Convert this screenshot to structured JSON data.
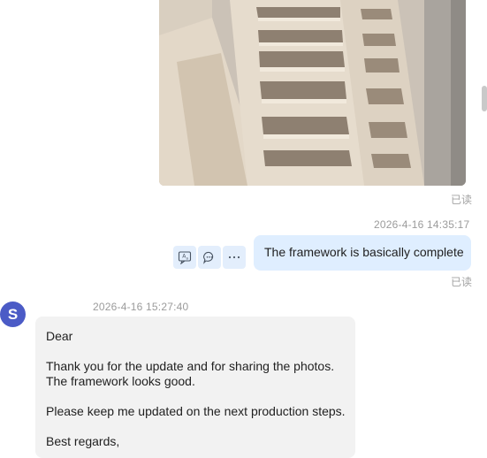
{
  "chat": {
    "image_message": {
      "read_status": "已读"
    },
    "outgoing_message": {
      "timestamp": "2026-4-16 14:35:17",
      "text": "The framework is basically complete",
      "read_status": "已读",
      "actions": [
        {
          "icon": "translate-icon"
        },
        {
          "icon": "reply-icon"
        },
        {
          "icon": "more-icon"
        }
      ]
    },
    "incoming_message": {
      "avatar_letter": "S",
      "avatar_color": "#4b5bc6",
      "timestamp": "2026-4-16 15:27:40",
      "lines": {
        "greeting": "Dear",
        "body1_line1": "Thank you for the update and for sharing the photos.",
        "body1_line2": "The framework looks good.",
        "body2": "Please keep me updated on the next production steps.",
        "closing": "Best regards,"
      }
    }
  },
  "colors": {
    "outgoing_bubble": "#dfeeff",
    "incoming_bubble": "#f2f2f2",
    "action_button_bg": "#e3eefc"
  }
}
